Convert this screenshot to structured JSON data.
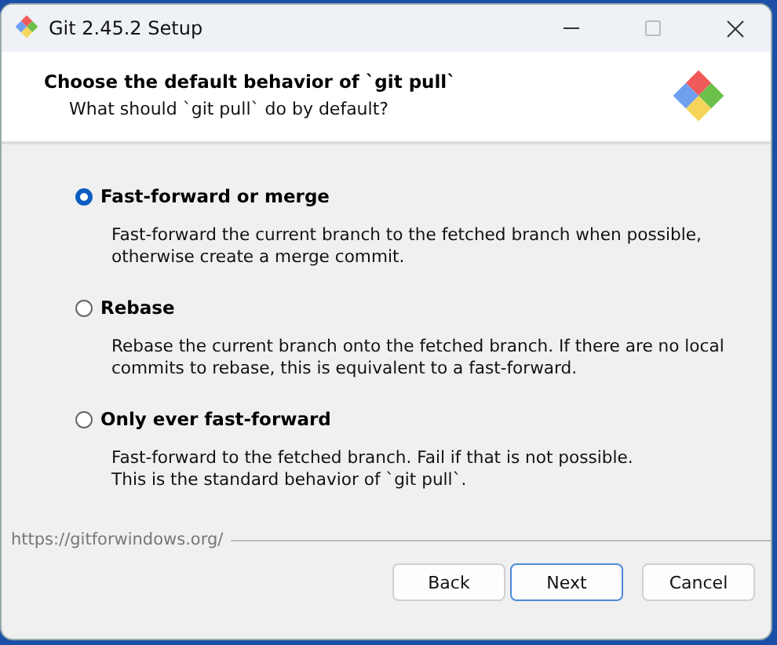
{
  "window": {
    "title": "Git 2.45.2 Setup"
  },
  "header": {
    "title": "Choose the default behavior of `git pull`",
    "subtitle": "What should `git pull` do by default?"
  },
  "options": [
    {
      "label": "Fast-forward or merge",
      "description": "Fast-forward the current branch to the fetched branch when possible, otherwise create a merge commit.",
      "selected": true
    },
    {
      "label": "Rebase",
      "description": "Rebase the current branch onto the fetched branch. If there are no local commits to rebase, this is equivalent to a fast-forward.",
      "selected": false
    },
    {
      "label": "Only ever fast-forward",
      "description": "Fast-forward to the fetched branch. Fail if that is not possible.\nThis is the standard behavior of `git pull`.",
      "selected": false
    }
  ],
  "footer_link": "https://gitforwindows.org/",
  "buttons": [
    {
      "label": "Back",
      "default": false
    },
    {
      "label": "Next",
      "default": true
    },
    {
      "label": "Cancel",
      "default": false
    }
  ]
}
